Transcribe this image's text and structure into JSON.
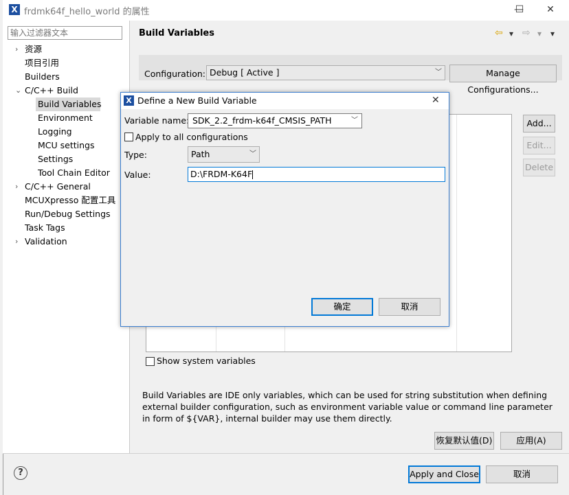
{
  "window": {
    "title": "frdmk64f_hello_world 的属性",
    "app_icon": "X",
    "minimize": "—",
    "maximize": "☐",
    "close": "✕"
  },
  "sidebar": {
    "filter_placeholder": "输入过滤器文本",
    "items": [
      {
        "label": "资源",
        "twisty": "›"
      },
      {
        "label": "项目引用",
        "twisty": ""
      },
      {
        "label": "Builders",
        "twisty": ""
      },
      {
        "label": "C/C++ Build",
        "twisty": "⌄"
      },
      {
        "label": "Build Variables",
        "twisty": ""
      },
      {
        "label": "Environment",
        "twisty": ""
      },
      {
        "label": "Logging",
        "twisty": ""
      },
      {
        "label": "MCU settings",
        "twisty": ""
      },
      {
        "label": "Settings",
        "twisty": ""
      },
      {
        "label": "Tool Chain Editor",
        "twisty": ""
      },
      {
        "label": "C/C++ General",
        "twisty": "›"
      },
      {
        "label": "MCUXpresso 配置工具",
        "twisty": ""
      },
      {
        "label": "Run/Debug Settings",
        "twisty": ""
      },
      {
        "label": "Task Tags",
        "twisty": ""
      },
      {
        "label": "Validation",
        "twisty": "›"
      }
    ]
  },
  "main": {
    "title": "Build Variables",
    "back_icon": "⇦",
    "forward_icon": "⇨",
    "dropdown_icon": "▾",
    "configuration_label": "Configuration:",
    "configuration_value": "Debug  [ Active ]",
    "manage_button": "Manage Configurations...",
    "add_button": "Add...",
    "edit_button": "Edit...",
    "delete_button": "Delete",
    "show_system_label": "Show system variables",
    "description": "Build Variables are IDE only variables, which can be used for string substitution when defining external builder configuration, such as environment variable value or command line parameter in form of ${VAR}, internal builder may use them directly.",
    "restore_button": "恢复默认值(D)",
    "apply_button": "应用(A)"
  },
  "footer": {
    "help_icon": "?",
    "apply_close_button": "Apply and Close",
    "cancel_button": "取消"
  },
  "dialog": {
    "title": "Define a New Build Variable",
    "close": "✕",
    "variable_name_label": "Variable name:",
    "variable_name_value": "SDK_2.2_frdm-k64f_CMSIS_PATH",
    "apply_all_label": "Apply to all configurations",
    "type_label": "Type:",
    "type_value": "Path",
    "value_label": "Value:",
    "value_value": "D:\\FRDM-K64F",
    "ok_button": "确定",
    "cancel_button": "取消"
  }
}
